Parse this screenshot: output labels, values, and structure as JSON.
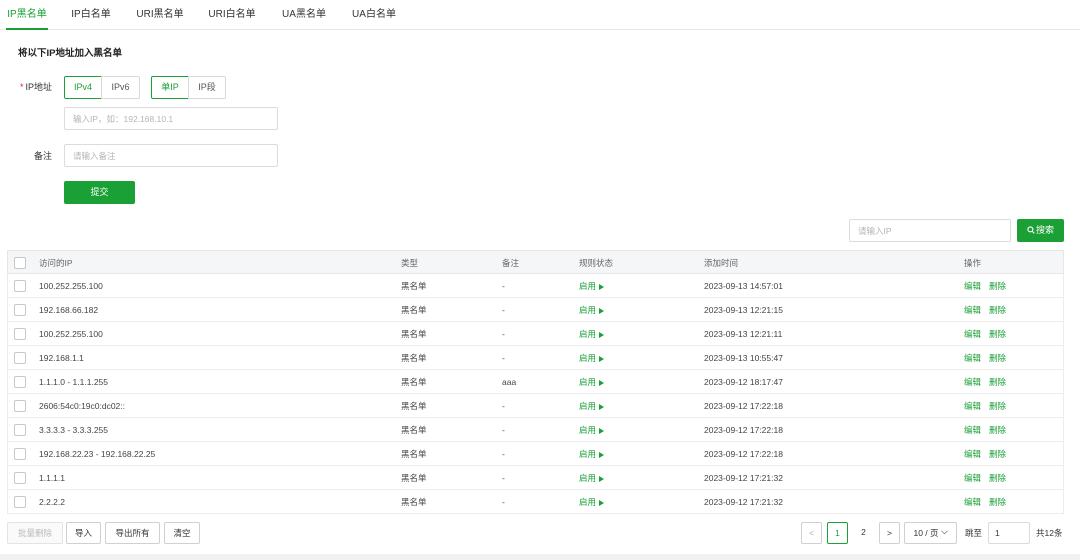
{
  "tabs": [
    {
      "label": "IP黑名单",
      "active": true
    },
    {
      "label": "IP白名单"
    },
    {
      "label": "URI黑名单"
    },
    {
      "label": "URI白名单"
    },
    {
      "label": "UA黑名单"
    },
    {
      "label": "UA白名单"
    }
  ],
  "form": {
    "title": "将以下IP地址加入黑名单",
    "required_mark": "*",
    "ip_label": "IP地址",
    "ip_version_options": [
      "IPv4",
      "IPv6"
    ],
    "ip_version_selected": "IPv4",
    "ip_mode_options": [
      "单IP",
      "IP段"
    ],
    "ip_mode_selected": "单IP",
    "ip_placeholder": "输入IP，如：192.168.10.1",
    "note_label": "备注",
    "note_placeholder": "请输入备注",
    "submit_label": "提交"
  },
  "search": {
    "placeholder": "请输入IP",
    "button_label": "搜索"
  },
  "table": {
    "columns": [
      "访问的IP",
      "类型",
      "备注",
      "规则状态",
      "添加时间",
      "操作"
    ],
    "rows": [
      {
        "ip": "100.252.255.100",
        "type": "黑名单",
        "note": "-",
        "status": "启用",
        "time": "2023-09-13 14:57:01"
      },
      {
        "ip": "192.168.66.182",
        "type": "黑名单",
        "note": "-",
        "status": "启用",
        "time": "2023-09-13 12:21:15"
      },
      {
        "ip": "100.252.255.100",
        "type": "黑名单",
        "note": "-",
        "status": "启用",
        "time": "2023-09-13 12:21:11"
      },
      {
        "ip": "192.168.1.1",
        "type": "黑名单",
        "note": "-",
        "status": "启用",
        "time": "2023-09-13 10:55:47"
      },
      {
        "ip": "1.1.1.0 - 1.1.1.255",
        "type": "黑名单",
        "note": "aaa",
        "status": "启用",
        "time": "2023-09-12 18:17:47"
      },
      {
        "ip": "2606:54c0:19c0:dc02::",
        "type": "黑名单",
        "note": "-",
        "status": "启用",
        "time": "2023-09-12 17:22:18"
      },
      {
        "ip": "3.3.3.3 - 3.3.3.255",
        "type": "黑名单",
        "note": "-",
        "status": "启用",
        "time": "2023-09-12 17:22:18"
      },
      {
        "ip": "192.168.22.23 - 192.168.22.25",
        "type": "黑名单",
        "note": "-",
        "status": "启用",
        "time": "2023-09-12 17:22:18"
      },
      {
        "ip": "1.1.1.1",
        "type": "黑名单",
        "note": "-",
        "status": "启用",
        "time": "2023-09-12 17:21:32"
      },
      {
        "ip": "2.2.2.2",
        "type": "黑名单",
        "note": "-",
        "status": "启用",
        "time": "2023-09-12 17:21:32"
      }
    ],
    "edit_label": "编辑",
    "delete_label": "删除"
  },
  "footer": {
    "batch_delete": "批量删除",
    "import": "导入",
    "export_all": "导出所有",
    "clear": "清空"
  },
  "pagination": {
    "prev": "<",
    "next": ">",
    "pages": [
      "1",
      "2"
    ],
    "current": "1",
    "page_size": "10 / 页",
    "goto_label": "跳至",
    "goto_value": "1",
    "total": "共12条"
  },
  "colors": {
    "accent": "#1aa035"
  },
  "icons": {
    "search": "search-icon",
    "status": "play-icon",
    "dropdown": "chevron-down-icon"
  }
}
